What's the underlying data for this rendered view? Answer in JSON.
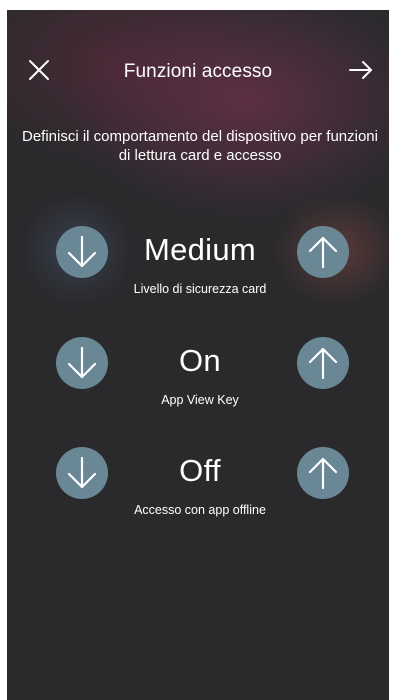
{
  "header": {
    "title": "Funzioni accesso",
    "close_icon": "close-icon",
    "next_icon": "arrow-right-icon"
  },
  "description": "Definisci il comportamento del dispositivo per funzioni di lettura card e accesso",
  "settings": [
    {
      "value": "Medium",
      "label": "Livello di sicurezza card"
    },
    {
      "value": "On",
      "label": "App View Key"
    },
    {
      "value": "Off",
      "label": "Accesso con app offline"
    }
  ],
  "icons": {
    "decrease": "arrow-down-icon",
    "increase": "arrow-up-icon"
  },
  "colors": {
    "background": "#2a2a2d",
    "button": "#6a8796",
    "text": "#ffffff",
    "glow": "#78324f"
  }
}
